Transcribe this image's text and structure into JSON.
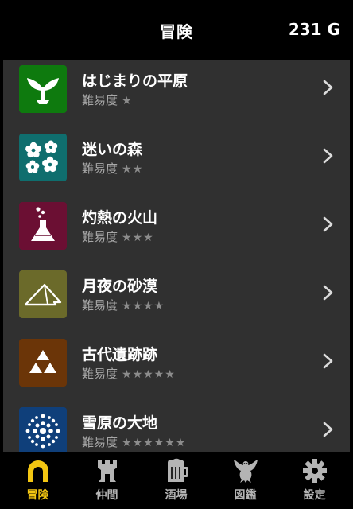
{
  "header": {
    "title": "冒険",
    "gold": "231 G"
  },
  "difficulty_label": "難易度",
  "areas": [
    {
      "name": "はじまりの平原",
      "difficulty_label": "難易度",
      "stars": "★",
      "star_count": 1,
      "icon": "sprout-icon",
      "color": "#0e7a0e"
    },
    {
      "name": "迷いの森",
      "difficulty_label": "難易度",
      "stars": "★★",
      "star_count": 2,
      "icon": "flowers-icon",
      "color": "#0f6e6e"
    },
    {
      "name": "灼熱の火山",
      "difficulty_label": "難易度",
      "stars": "★★★",
      "star_count": 3,
      "icon": "volcano-flask-icon",
      "color": "#6b0f33"
    },
    {
      "name": "月夜の砂漠",
      "difficulty_label": "難易度",
      "stars": "★★★★",
      "star_count": 4,
      "icon": "tent-icon",
      "color": "#6b6a2a"
    },
    {
      "name": "古代遺跡跡",
      "difficulty_label": "難易度",
      "stars": "★★★★★",
      "star_count": 5,
      "icon": "triforce-icon",
      "color": "#6b3508"
    },
    {
      "name": "雪原の大地",
      "difficulty_label": "難易度",
      "stars": "★★★★★★",
      "star_count": 6,
      "icon": "snowflake-icon",
      "color": "#0f3f7a"
    }
  ],
  "tabs": [
    {
      "label": "冒険",
      "icon": "arch-icon",
      "active": true
    },
    {
      "label": "仲間",
      "icon": "castle-tower-icon",
      "active": false
    },
    {
      "label": "酒場",
      "icon": "beer-mug-icon",
      "active": false
    },
    {
      "label": "図鑑",
      "icon": "dragon-icon",
      "active": false
    },
    {
      "label": "設定",
      "icon": "gear-icon",
      "active": false
    }
  ],
  "colors": {
    "accent": "#f3c612",
    "list_bg": "#303030",
    "inactive_tab": "#b4b4b4"
  }
}
